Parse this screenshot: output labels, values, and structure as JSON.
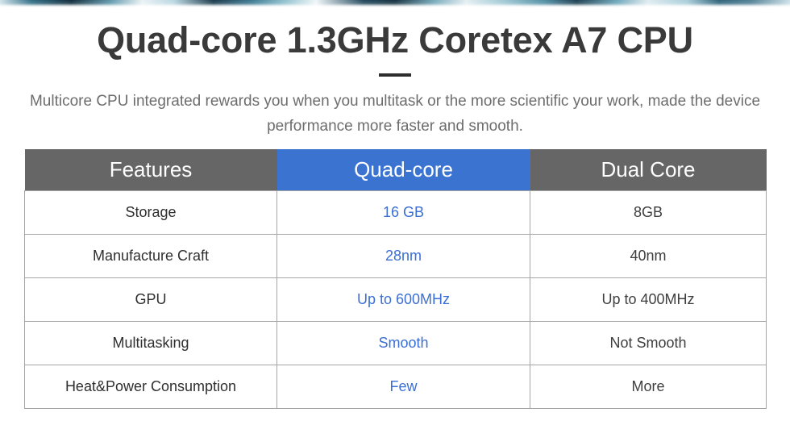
{
  "decor": {
    "top_bleed_name": "image-strip-bleed",
    "divider_name": "title-divider"
  },
  "header": {
    "title": "Quad-core 1.3GHz Coretex A7 CPU",
    "subtitle": "Multicore CPU integrated rewards you when you multitask or the more scientific your work, made the device performance more faster and smooth."
  },
  "colors": {
    "header_gray": "#666666",
    "header_blue": "#3b73d1",
    "highlight_text": "#3b6fd4",
    "body_text": "#2f2f2f",
    "subtitle_text": "#6d6d6d",
    "title_text": "#3a3a3a",
    "table_border": "#a5a5a5"
  },
  "table": {
    "columns": [
      {
        "label": "Features",
        "style": "gray"
      },
      {
        "label": "Quad-core",
        "style": "blue"
      },
      {
        "label": "Dual Core",
        "style": "gray"
      }
    ],
    "rows": [
      {
        "feature": "Storage",
        "quad_core": "16 GB",
        "dual_core": "8GB"
      },
      {
        "feature": "Manufacture Craft",
        "quad_core": "28nm",
        "dual_core": "40nm"
      },
      {
        "feature": "GPU",
        "quad_core": "Up to 600MHz",
        "dual_core": "Up to 400MHz"
      },
      {
        "feature": "Multitasking",
        "quad_core": "Smooth",
        "dual_core": "Not Smooth"
      },
      {
        "feature": "Heat&Power Consumption",
        "quad_core": "Few",
        "dual_core": "More"
      }
    ]
  }
}
